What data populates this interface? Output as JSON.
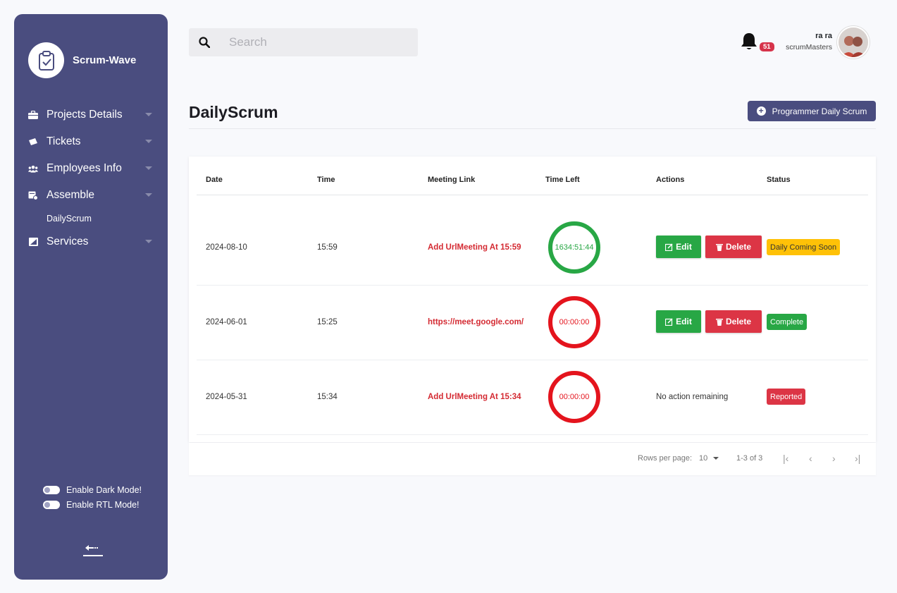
{
  "sidebar": {
    "brand": "Scrum-Wave",
    "items": [
      {
        "label": "Projects Details"
      },
      {
        "label": "Tickets"
      },
      {
        "label": "Employees Info"
      },
      {
        "label": "Assemble"
      },
      {
        "label": "DailyScrum"
      },
      {
        "label": "Services"
      }
    ],
    "dark_mode": "Enable Dark Mode!",
    "rtl_mode": "Enable RTL Mode!"
  },
  "search": {
    "placeholder": "Search"
  },
  "header": {
    "notification_count": "51",
    "user_name": "ra ra",
    "user_role": "scrumMasters"
  },
  "page": {
    "title": "DailyScrum",
    "action_button": "Programmer Daily Scrum"
  },
  "table": {
    "headers": [
      "Date",
      "Time",
      "Meeting Link",
      "Time Left",
      "Actions",
      "Status"
    ],
    "edit_label": "Edit",
    "delete_label": "Delete",
    "rows": [
      {
        "date": "2024-08-10",
        "time": "15:59",
        "link": "Add UrlMeeting At 15:59",
        "time_left": "1634:51:44",
        "action_note": "",
        "status": "Daily Coming Soon"
      },
      {
        "date": "2024-06-01",
        "time": "15:25",
        "link": "https://meet.google.com/",
        "time_left": "00:00:00",
        "action_note": "",
        "status": "Complete"
      },
      {
        "date": "2024-05-31",
        "time": "15:34",
        "link": "Add UrlMeeting At 15:34",
        "time_left": "00:00:00",
        "action_note": "No action remaining",
        "status": "Reported"
      }
    ]
  },
  "pagination": {
    "rows_per_page_label": "Rows per page:",
    "rows_per_page": "10",
    "range": "1-3 of 3"
  },
  "colors": {
    "sidebar": "#4a4d7f",
    "timer_active": "#28a745",
    "timer_expired": "#e4141d",
    "status_soon": "#ffc107",
    "status_complete": "#28a745",
    "status_reported": "#dc3545"
  }
}
